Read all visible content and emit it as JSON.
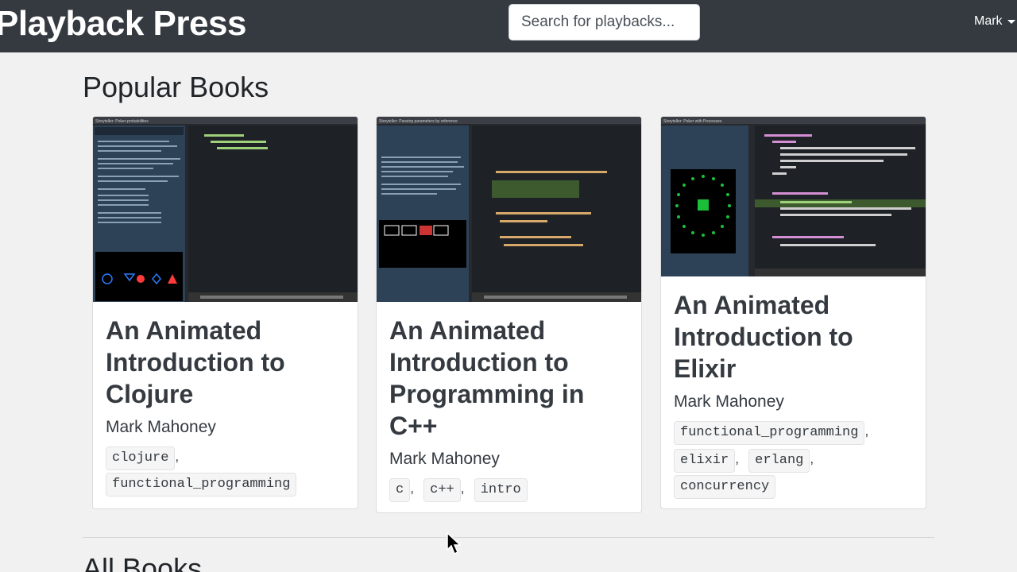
{
  "navbar": {
    "brand": "Playback Press",
    "search_placeholder": "Search for playbacks...",
    "user": "Mark"
  },
  "popular": {
    "heading": "Popular Books",
    "cards": [
      {
        "title": "An Animated Introduction to Clojure",
        "author": "Mark Mahoney",
        "tags": [
          "clojure",
          "functional_programming"
        ],
        "thumb_header": "Storyteller: Poker-probabilities"
      },
      {
        "title": "An Animated Introduction to Programming in C++",
        "author": "Mark Mahoney",
        "tags": [
          "c",
          "c++",
          "intro"
        ],
        "thumb_header": "Storyteller: Passing parameters by reference"
      },
      {
        "title": "An Animated Introduction to Elixir",
        "author": "Mark Mahoney",
        "tags": [
          "functional_programming",
          "elixir",
          "erlang",
          "concurrency"
        ],
        "thumb_header": "Storyteller: Poker with Processes"
      }
    ]
  },
  "all_books": {
    "heading": "All Books"
  },
  "colors": {
    "navbar": "#343a40",
    "page_bg": "#f1f1f1",
    "card_title": "#343a40"
  }
}
